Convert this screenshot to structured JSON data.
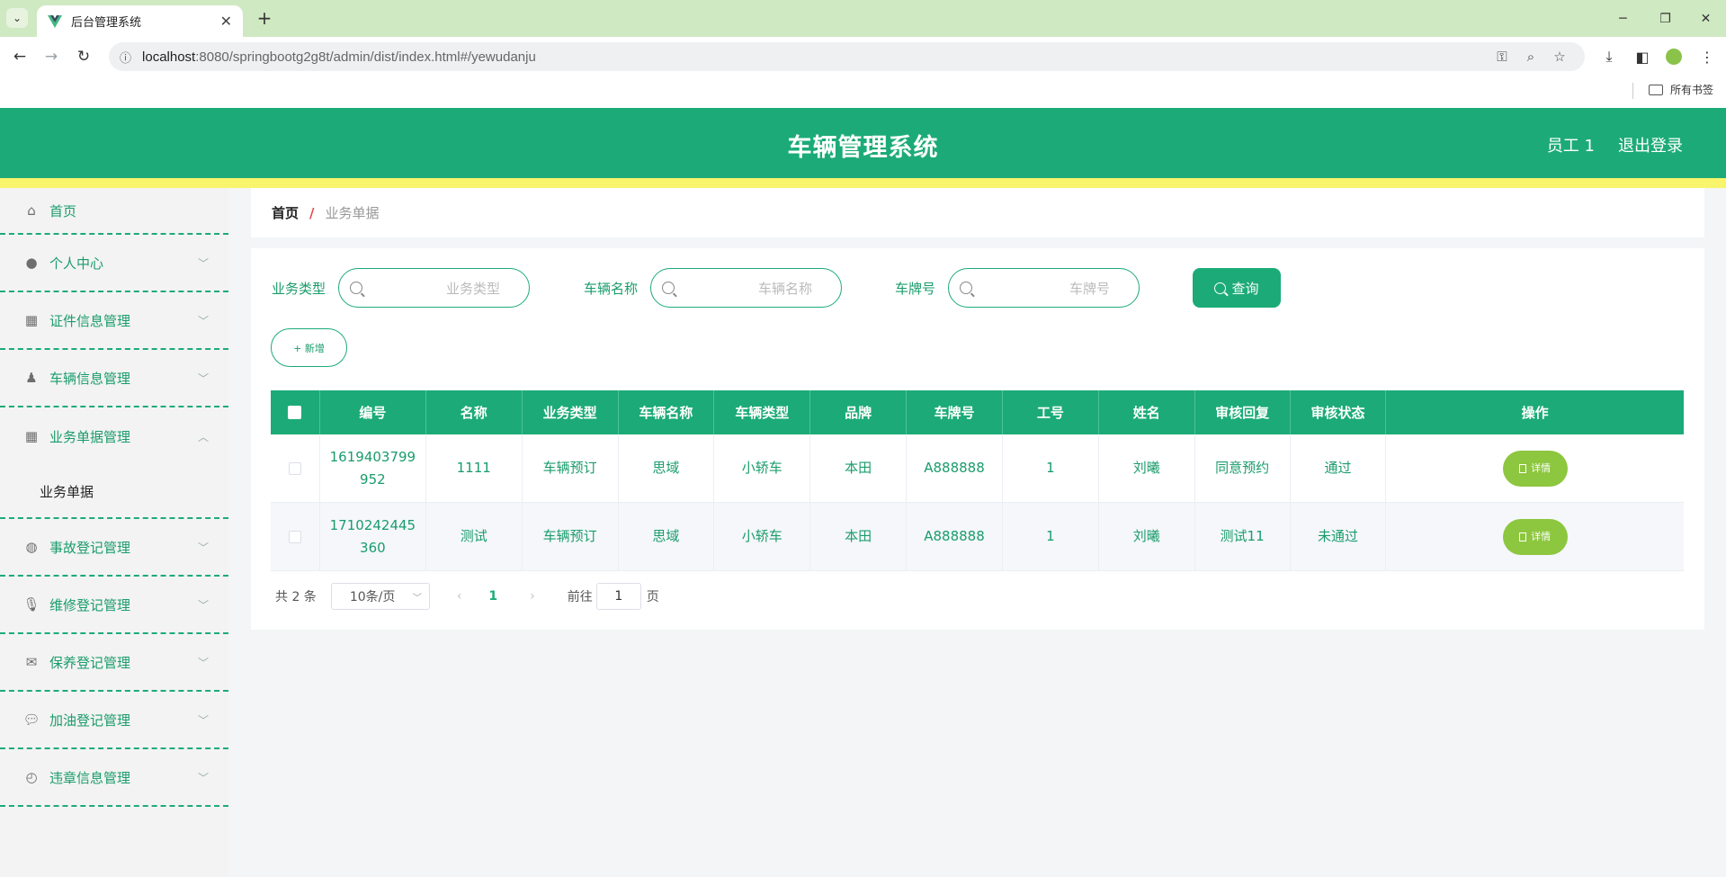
{
  "browser": {
    "tab_title": "后台管理系统",
    "url_host": "localhost",
    "url_rest": ":8080/springbootg2g8t/admin/dist/index.html#/yewudanju",
    "bookmarks_label": "所有书签"
  },
  "header": {
    "title": "车辆管理系统",
    "user": "员工 1",
    "logout": "退出登录"
  },
  "sidebar": {
    "items": [
      {
        "label": "首页",
        "icon": "home-icon"
      },
      {
        "label": "个人中心",
        "icon": "user-icon"
      },
      {
        "label": "证件信息管理",
        "icon": "grid-icon"
      },
      {
        "label": "车辆信息管理",
        "icon": "user-tie-icon"
      },
      {
        "label": "业务单据管理",
        "icon": "apps-icon"
      },
      {
        "label": "事故登记管理",
        "icon": "basketball-icon"
      },
      {
        "label": "维修登记管理",
        "icon": "microphone-icon"
      },
      {
        "label": "保养登记管理",
        "icon": "mail-icon"
      },
      {
        "label": "加油登记管理",
        "icon": "chat-icon"
      },
      {
        "label": "违章信息管理",
        "icon": "compass-icon"
      }
    ],
    "sub_item": "业务单据"
  },
  "breadcrumb": {
    "home": "首页",
    "sep": "/",
    "current": "业务单据"
  },
  "search": {
    "fields": [
      {
        "label": "业务类型",
        "placeholder": "业务类型"
      },
      {
        "label": "车辆名称",
        "placeholder": "车辆名称"
      },
      {
        "label": "车牌号",
        "placeholder": "车牌号"
      }
    ],
    "query_button": "查询",
    "add_button": "+ 新增"
  },
  "table": {
    "columns": [
      "编号",
      "名称",
      "业务类型",
      "车辆名称",
      "车辆类型",
      "品牌",
      "车牌号",
      "工号",
      "姓名",
      "审核回复",
      "审核状态",
      "操作"
    ],
    "rows": [
      [
        "1619403799952",
        "1111",
        "车辆预订",
        "思域",
        "小轿车",
        "本田",
        "A888888",
        "1",
        "刘曦",
        "同意预约",
        "通过"
      ],
      [
        "1710242445360",
        "测试",
        "车辆预订",
        "思域",
        "小轿车",
        "本田",
        "A888888",
        "1",
        "刘曦",
        "测试11",
        "未通过"
      ]
    ],
    "detail_label": "详情"
  },
  "pagination": {
    "total": "共 2 条",
    "page_size": "10条/页",
    "current_page": "1",
    "goto": "前往",
    "goto_value": "1",
    "page_suffix": "页"
  }
}
